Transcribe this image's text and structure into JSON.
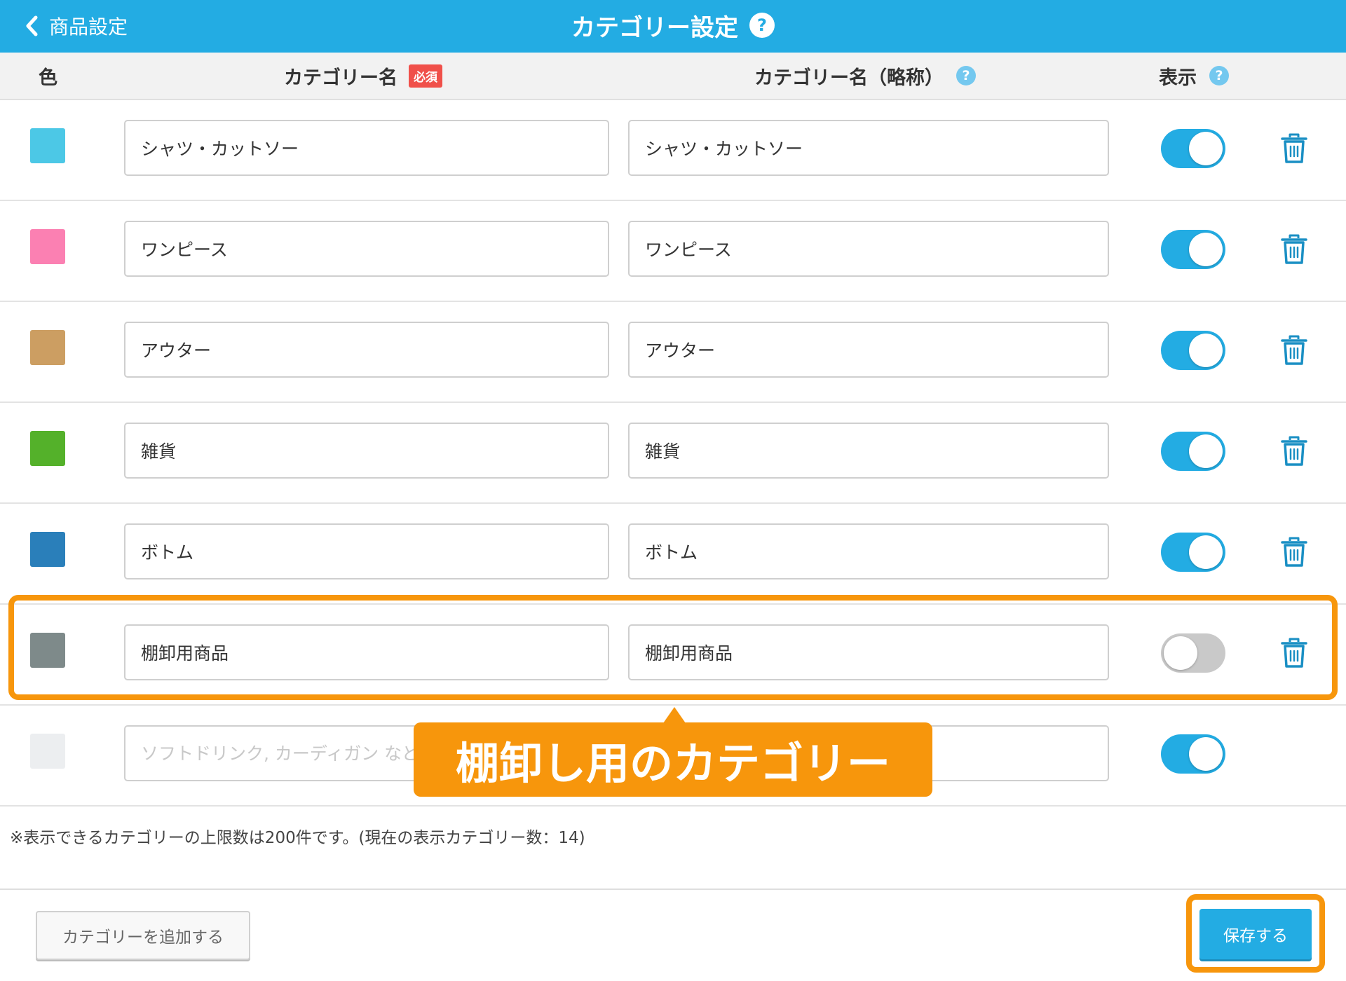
{
  "header": {
    "back_label": "商品設定",
    "title": "カテゴリー設定",
    "help_glyph": "?"
  },
  "columns": {
    "color": "色",
    "name": "カテゴリー名",
    "required_badge": "必須",
    "short_name": "カテゴリー名（略称）",
    "display": "表示",
    "help_glyph": "?"
  },
  "rows": [
    {
      "color": "#4cc8e6",
      "name": "シャツ・カットソー",
      "short": "シャツ・カットソー",
      "display_on": true
    },
    {
      "color": "#fb80b2",
      "name": "ワンピース",
      "short": "ワンピース",
      "display_on": true
    },
    {
      "color": "#cc9e62",
      "name": "アウター",
      "short": "アウター",
      "display_on": true
    },
    {
      "color": "#54b12a",
      "name": "雑貨",
      "short": "雑貨",
      "display_on": true
    },
    {
      "color": "#2a7fba",
      "name": "ボトム",
      "short": "ボトム",
      "display_on": true
    },
    {
      "color": "#7e8a8a",
      "name": "棚卸用商品",
      "short": "棚卸用商品",
      "display_on": false
    },
    {
      "color": "#eceef0",
      "name": "",
      "name_placeholder": "ソフトドリンク, カーディガン など",
      "short": "",
      "display_on": true
    }
  ],
  "callout": "棚卸し用のカテゴリー",
  "note": "※表示できるカテゴリーの上限数は200件です。(現在の表示カテゴリー数：14)",
  "footer": {
    "add_label": "カテゴリーを追加する",
    "save_label": "保存する"
  },
  "colors": {
    "brand": "#23ace3",
    "highlight": "#f7960c",
    "required": "#f0504a",
    "toggle_off": "#c9c9c9"
  },
  "icons": {
    "back": "chevron-left-icon",
    "help": "question-circle-icon",
    "delete": "trash-icon"
  }
}
